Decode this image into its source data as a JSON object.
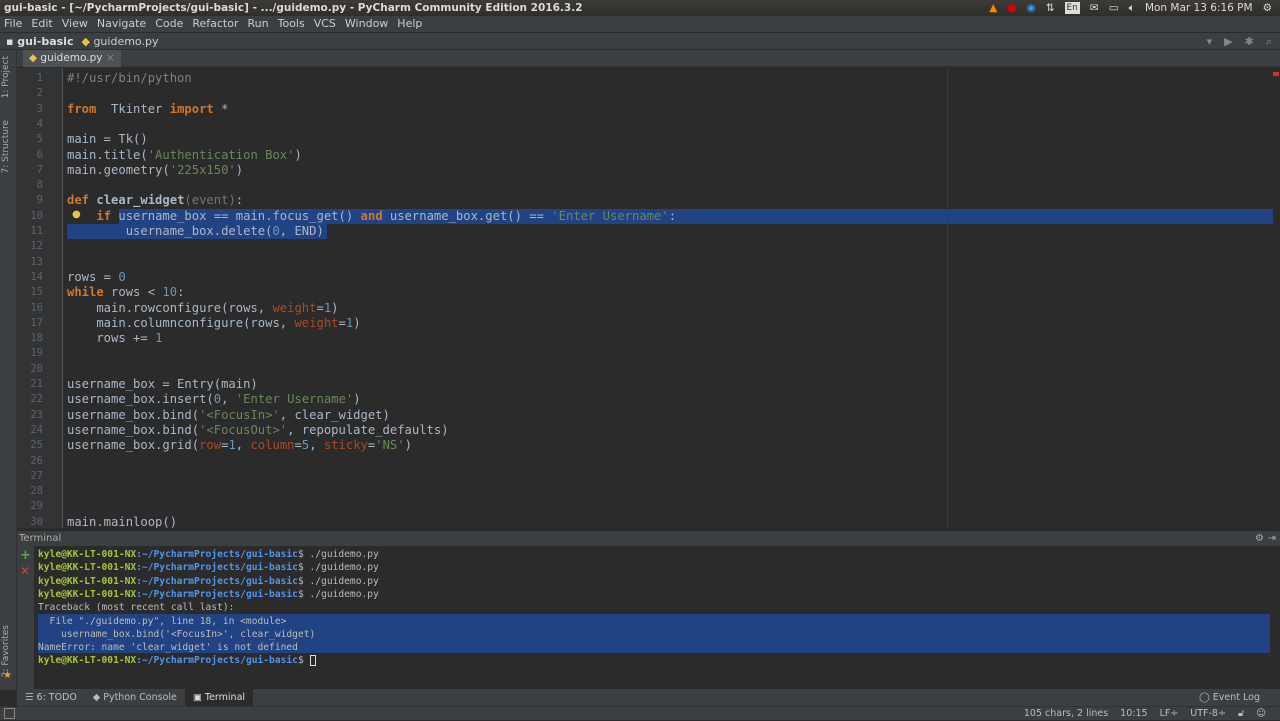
{
  "window": {
    "title": "gui-basic - [~/PycharmProjects/gui-basic] - .../guidemo.py - PyCharm Community Edition 2016.3.2"
  },
  "tray": {
    "datetime": "Mon Mar 13  6:16 PM",
    "keyboard": "En",
    "icons": [
      "vlc-icon",
      "record-icon",
      "teamviewer-icon",
      "network-icon",
      "keyboard-icon",
      "mail-icon",
      "battery-icon",
      "volume-icon",
      "power-icon"
    ]
  },
  "menu": [
    "File",
    "Edit",
    "View",
    "Navigate",
    "Code",
    "Refactor",
    "Run",
    "Tools",
    "VCS",
    "Window",
    "Help"
  ],
  "breadcrumb": {
    "project": "gui-basic",
    "file": "guidemo.py"
  },
  "sidebar": {
    "project": "1: Project",
    "structure": "7: Structure",
    "favorites": "2: Favorites"
  },
  "tab": {
    "label": "guidemo.py",
    "close": "×"
  },
  "code": [
    [
      [
        "cm",
        "#!/usr/bin/python"
      ]
    ],
    [],
    [
      [
        "kw",
        "from"
      ],
      [
        "",
        "  Tkinter "
      ],
      [
        "kw",
        "import"
      ],
      [
        "",
        " *"
      ]
    ],
    [],
    [
      [
        "",
        "main = Tk()"
      ]
    ],
    [
      [
        "",
        "main.title("
      ],
      [
        "str",
        "'Authentication Box'"
      ],
      [
        "",
        ")"
      ]
    ],
    [
      [
        "",
        "main.geometry("
      ],
      [
        "str",
        "'225x150'"
      ],
      [
        "",
        ")"
      ]
    ],
    [],
    [
      [
        "kw",
        "def"
      ],
      [
        "",
        " "
      ],
      [
        "fnd",
        "clear_widget"
      ],
      [
        "par",
        "(event)"
      ],
      [
        "",
        ":"
      ]
    ],
    [
      [
        "",
        "    "
      ],
      [
        "kw",
        "if"
      ],
      [
        "",
        " username_box == main.focus_get() "
      ],
      [
        "kw",
        "and"
      ],
      [
        "",
        " username_box.get() == "
      ],
      [
        "str",
        "'Enter Username'"
      ],
      [
        "",
        ":"
      ]
    ],
    [
      [
        "",
        "        username_box.delete("
      ],
      [
        "num",
        "0"
      ],
      [
        "",
        ", END)"
      ]
    ],
    [],
    [],
    [
      [
        "",
        "rows = "
      ],
      [
        "num",
        "0"
      ]
    ],
    [
      [
        "kw",
        "while"
      ],
      [
        "",
        " rows < "
      ],
      [
        "num",
        "10"
      ],
      [
        "",
        ":"
      ]
    ],
    [
      [
        "",
        "    main.rowconfigure(rows, "
      ],
      [
        "kwa",
        "weight"
      ],
      [
        "",
        "="
      ],
      [
        "num",
        "1"
      ],
      [
        "",
        ")"
      ]
    ],
    [
      [
        "",
        "    main.columnconfigure(rows, "
      ],
      [
        "kwa",
        "weight"
      ],
      [
        "",
        "="
      ],
      [
        "num",
        "1"
      ],
      [
        "",
        ")"
      ]
    ],
    [
      [
        "",
        "    rows += "
      ],
      [
        "num",
        "1"
      ]
    ],
    [],
    [],
    [
      [
        "",
        "username_box = Entry(main)"
      ]
    ],
    [
      [
        "",
        "username_box.insert("
      ],
      [
        "num",
        "0"
      ],
      [
        "",
        ", "
      ],
      [
        "str",
        "'Enter Username'"
      ],
      [
        "",
        ")"
      ]
    ],
    [
      [
        "",
        "username_box.bind("
      ],
      [
        "str",
        "'<FocusIn>'"
      ],
      [
        "",
        ", clear_widget)"
      ]
    ],
    [
      [
        "",
        "username_box.bind("
      ],
      [
        "str",
        "'<FocusOut>'"
      ],
      [
        "",
        ", repopulate_defaults)"
      ]
    ],
    [
      [
        "",
        "username_box.grid("
      ],
      [
        "kwa",
        "row"
      ],
      [
        "",
        "="
      ],
      [
        "num",
        "1"
      ],
      [
        "",
        ", "
      ],
      [
        "kwa",
        "column"
      ],
      [
        "",
        "="
      ],
      [
        "num",
        "5"
      ],
      [
        "",
        ", "
      ],
      [
        "kwa",
        "sticky"
      ],
      [
        "",
        "="
      ],
      [
        "str",
        "'NS'"
      ],
      [
        "",
        ")"
      ]
    ],
    [],
    [],
    [],
    [],
    [
      [
        "",
        "main.mainloop()"
      ]
    ]
  ],
  "terminal": {
    "title": "Terminal",
    "prompt_user": "kyle@KK-LT-001-NX",
    "prompt_path": ":~/PycharmProjects/gui-basic",
    "lines": [
      {
        "p": true,
        "text": "$ ./guidemo.py"
      },
      {
        "p": true,
        "text": "$ ./guidemo.py"
      },
      {
        "p": true,
        "text": "$ ./guidemo.py"
      },
      {
        "p": true,
        "text": "$ ./guidemo.py"
      },
      {
        "p": false,
        "text": "Traceback (most recent call last):"
      },
      {
        "p": false,
        "text": "  File \"./guidemo.py\", line 18, in <module>"
      },
      {
        "p": false,
        "text": "    username_box.bind('<FocusIn>', clear_widget)"
      },
      {
        "p": false,
        "text": "NameError: name 'clear_widget' is not defined"
      },
      {
        "p": true,
        "text": "$ "
      }
    ]
  },
  "toolwindows": {
    "todo": "6: TODO",
    "console": "Python Console",
    "terminal": "Terminal"
  },
  "status": {
    "event_log": "Event Log",
    "selection": "105 chars, 2 lines",
    "position": "10:15",
    "line_sep": "LF÷",
    "encoding": "UTF-8÷"
  }
}
